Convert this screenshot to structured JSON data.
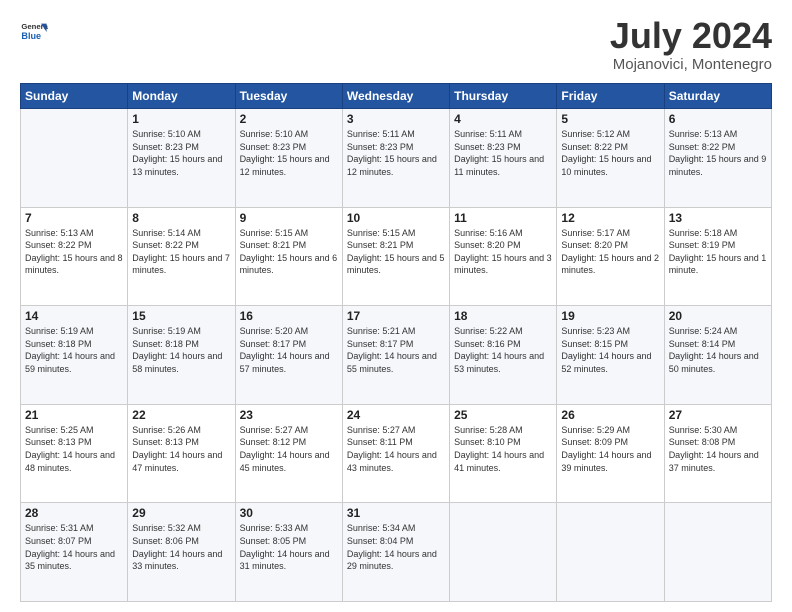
{
  "header": {
    "logo": {
      "general": "General",
      "blue": "Blue"
    },
    "title": "July 2024",
    "subtitle": "Mojanovici, Montenegro"
  },
  "calendar": {
    "days": [
      "Sunday",
      "Monday",
      "Tuesday",
      "Wednesday",
      "Thursday",
      "Friday",
      "Saturday"
    ],
    "weeks": [
      [
        {
          "day": "",
          "sunrise": "",
          "sunset": "",
          "daylight": ""
        },
        {
          "day": "1",
          "sunrise": "Sunrise: 5:10 AM",
          "sunset": "Sunset: 8:23 PM",
          "daylight": "Daylight: 15 hours and 13 minutes."
        },
        {
          "day": "2",
          "sunrise": "Sunrise: 5:10 AM",
          "sunset": "Sunset: 8:23 PM",
          "daylight": "Daylight: 15 hours and 12 minutes."
        },
        {
          "day": "3",
          "sunrise": "Sunrise: 5:11 AM",
          "sunset": "Sunset: 8:23 PM",
          "daylight": "Daylight: 15 hours and 12 minutes."
        },
        {
          "day": "4",
          "sunrise": "Sunrise: 5:11 AM",
          "sunset": "Sunset: 8:23 PM",
          "daylight": "Daylight: 15 hours and 11 minutes."
        },
        {
          "day": "5",
          "sunrise": "Sunrise: 5:12 AM",
          "sunset": "Sunset: 8:22 PM",
          "daylight": "Daylight: 15 hours and 10 minutes."
        },
        {
          "day": "6",
          "sunrise": "Sunrise: 5:13 AM",
          "sunset": "Sunset: 8:22 PM",
          "daylight": "Daylight: 15 hours and 9 minutes."
        }
      ],
      [
        {
          "day": "7",
          "sunrise": "Sunrise: 5:13 AM",
          "sunset": "Sunset: 8:22 PM",
          "daylight": "Daylight: 15 hours and 8 minutes."
        },
        {
          "day": "8",
          "sunrise": "Sunrise: 5:14 AM",
          "sunset": "Sunset: 8:22 PM",
          "daylight": "Daylight: 15 hours and 7 minutes."
        },
        {
          "day": "9",
          "sunrise": "Sunrise: 5:15 AM",
          "sunset": "Sunset: 8:21 PM",
          "daylight": "Daylight: 15 hours and 6 minutes."
        },
        {
          "day": "10",
          "sunrise": "Sunrise: 5:15 AM",
          "sunset": "Sunset: 8:21 PM",
          "daylight": "Daylight: 15 hours and 5 minutes."
        },
        {
          "day": "11",
          "sunrise": "Sunrise: 5:16 AM",
          "sunset": "Sunset: 8:20 PM",
          "daylight": "Daylight: 15 hours and 3 minutes."
        },
        {
          "day": "12",
          "sunrise": "Sunrise: 5:17 AM",
          "sunset": "Sunset: 8:20 PM",
          "daylight": "Daylight: 15 hours and 2 minutes."
        },
        {
          "day": "13",
          "sunrise": "Sunrise: 5:18 AM",
          "sunset": "Sunset: 8:19 PM",
          "daylight": "Daylight: 15 hours and 1 minute."
        }
      ],
      [
        {
          "day": "14",
          "sunrise": "Sunrise: 5:19 AM",
          "sunset": "Sunset: 8:18 PM",
          "daylight": "Daylight: 14 hours and 59 minutes."
        },
        {
          "day": "15",
          "sunrise": "Sunrise: 5:19 AM",
          "sunset": "Sunset: 8:18 PM",
          "daylight": "Daylight: 14 hours and 58 minutes."
        },
        {
          "day": "16",
          "sunrise": "Sunrise: 5:20 AM",
          "sunset": "Sunset: 8:17 PM",
          "daylight": "Daylight: 14 hours and 57 minutes."
        },
        {
          "day": "17",
          "sunrise": "Sunrise: 5:21 AM",
          "sunset": "Sunset: 8:17 PM",
          "daylight": "Daylight: 14 hours and 55 minutes."
        },
        {
          "day": "18",
          "sunrise": "Sunrise: 5:22 AM",
          "sunset": "Sunset: 8:16 PM",
          "daylight": "Daylight: 14 hours and 53 minutes."
        },
        {
          "day": "19",
          "sunrise": "Sunrise: 5:23 AM",
          "sunset": "Sunset: 8:15 PM",
          "daylight": "Daylight: 14 hours and 52 minutes."
        },
        {
          "day": "20",
          "sunrise": "Sunrise: 5:24 AM",
          "sunset": "Sunset: 8:14 PM",
          "daylight": "Daylight: 14 hours and 50 minutes."
        }
      ],
      [
        {
          "day": "21",
          "sunrise": "Sunrise: 5:25 AM",
          "sunset": "Sunset: 8:13 PM",
          "daylight": "Daylight: 14 hours and 48 minutes."
        },
        {
          "day": "22",
          "sunrise": "Sunrise: 5:26 AM",
          "sunset": "Sunset: 8:13 PM",
          "daylight": "Daylight: 14 hours and 47 minutes."
        },
        {
          "day": "23",
          "sunrise": "Sunrise: 5:27 AM",
          "sunset": "Sunset: 8:12 PM",
          "daylight": "Daylight: 14 hours and 45 minutes."
        },
        {
          "day": "24",
          "sunrise": "Sunrise: 5:27 AM",
          "sunset": "Sunset: 8:11 PM",
          "daylight": "Daylight: 14 hours and 43 minutes."
        },
        {
          "day": "25",
          "sunrise": "Sunrise: 5:28 AM",
          "sunset": "Sunset: 8:10 PM",
          "daylight": "Daylight: 14 hours and 41 minutes."
        },
        {
          "day": "26",
          "sunrise": "Sunrise: 5:29 AM",
          "sunset": "Sunset: 8:09 PM",
          "daylight": "Daylight: 14 hours and 39 minutes."
        },
        {
          "day": "27",
          "sunrise": "Sunrise: 5:30 AM",
          "sunset": "Sunset: 8:08 PM",
          "daylight": "Daylight: 14 hours and 37 minutes."
        }
      ],
      [
        {
          "day": "28",
          "sunrise": "Sunrise: 5:31 AM",
          "sunset": "Sunset: 8:07 PM",
          "daylight": "Daylight: 14 hours and 35 minutes."
        },
        {
          "day": "29",
          "sunrise": "Sunrise: 5:32 AM",
          "sunset": "Sunset: 8:06 PM",
          "daylight": "Daylight: 14 hours and 33 minutes."
        },
        {
          "day": "30",
          "sunrise": "Sunrise: 5:33 AM",
          "sunset": "Sunset: 8:05 PM",
          "daylight": "Daylight: 14 hours and 31 minutes."
        },
        {
          "day": "31",
          "sunrise": "Sunrise: 5:34 AM",
          "sunset": "Sunset: 8:04 PM",
          "daylight": "Daylight: 14 hours and 29 minutes."
        },
        {
          "day": "",
          "sunrise": "",
          "sunset": "",
          "daylight": ""
        },
        {
          "day": "",
          "sunrise": "",
          "sunset": "",
          "daylight": ""
        },
        {
          "day": "",
          "sunrise": "",
          "sunset": "",
          "daylight": ""
        }
      ]
    ]
  }
}
